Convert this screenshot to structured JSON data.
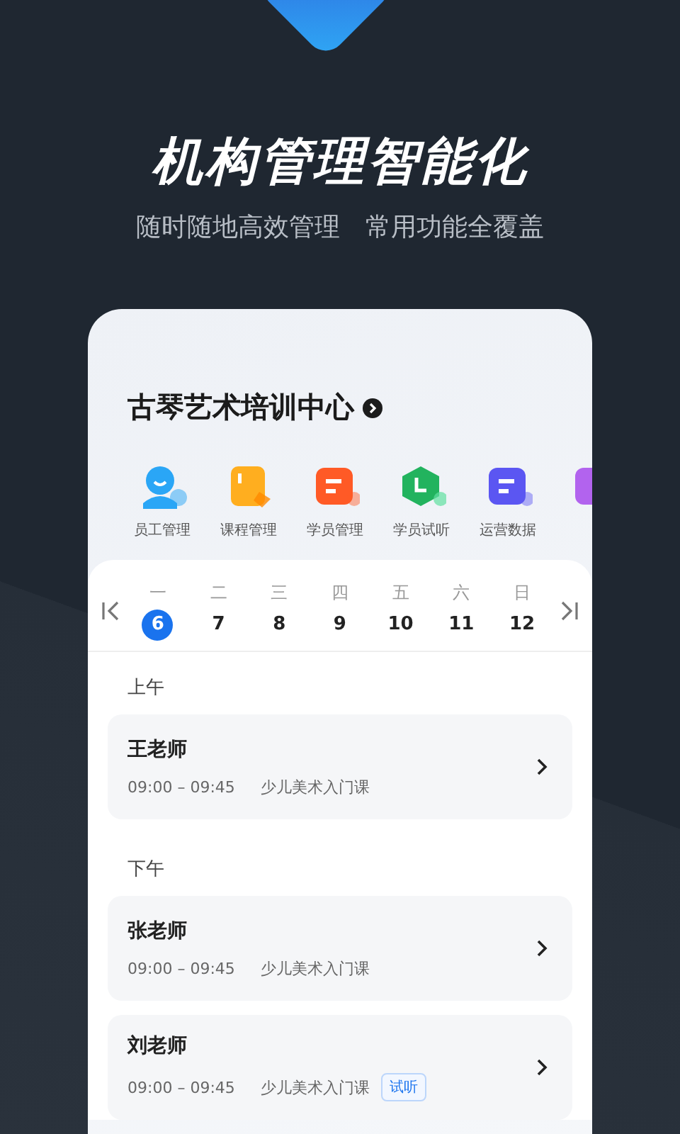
{
  "headline": "机构管理智能化",
  "subheadline": [
    "随时随地高效管理",
    "常用功能全覆盖"
  ],
  "org": {
    "name": "古琴艺术培训中心"
  },
  "shortcuts": [
    {
      "kind": "person",
      "label": "员工管理",
      "color": "#2aa6f6"
    },
    {
      "kind": "book",
      "label": "课程管理",
      "color": "#ffae1f"
    },
    {
      "kind": "list",
      "label": "学员管理",
      "color": "#ff5a26"
    },
    {
      "kind": "clock",
      "label": "学员试听",
      "color": "#22b35e"
    },
    {
      "kind": "list",
      "label": "运营数据",
      "color": "#5b56f2"
    },
    {
      "kind": "partial",
      "color": "#b263ee"
    }
  ],
  "week": [
    {
      "weekday": "一",
      "date": "6",
      "selected": true
    },
    {
      "weekday": "二",
      "date": "7",
      "selected": false
    },
    {
      "weekday": "三",
      "date": "8",
      "selected": false
    },
    {
      "weekday": "四",
      "date": "9",
      "selected": false
    },
    {
      "weekday": "五",
      "date": "10",
      "selected": false
    },
    {
      "weekday": "六",
      "date": "11",
      "selected": false
    },
    {
      "weekday": "日",
      "date": "12",
      "selected": false
    }
  ],
  "sections": [
    {
      "title": "上午",
      "lessons": [
        {
          "teacher": "王老师",
          "time": "09:00 – 09:45",
          "course": "少儿美术入门课"
        }
      ]
    },
    {
      "title": "下午",
      "lessons": [
        {
          "teacher": "张老师",
          "time": "09:00 – 09:45",
          "course": "少儿美术入门课"
        },
        {
          "teacher": "刘老师",
          "time": "09:00 – 09:45",
          "course": "少儿美术入门课",
          "tag": "试听"
        }
      ]
    }
  ]
}
